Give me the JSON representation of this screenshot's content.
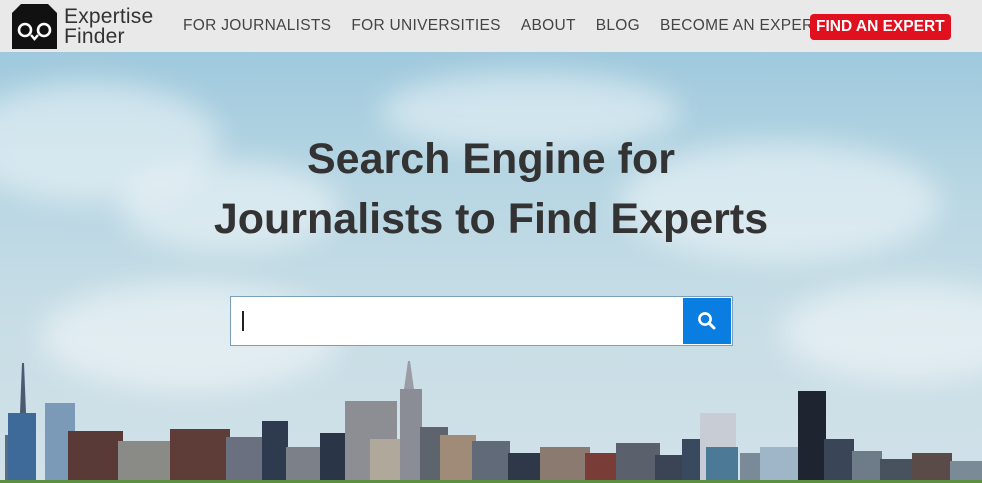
{
  "brand": {
    "line1": "Expertise",
    "line2": "Finder",
    "icon": "owl-logo-icon"
  },
  "nav": {
    "items": [
      {
        "label": "FOR JOURNALISTS"
      },
      {
        "label": "FOR UNIVERSITIES"
      },
      {
        "label": "ABOUT"
      },
      {
        "label": "BLOG"
      },
      {
        "label": "BECOME AN EXPERT"
      }
    ],
    "cta_label": "FIND AN EXPERT",
    "cta_color": "#e0101e"
  },
  "hero": {
    "headline_line1": "Search Engine for",
    "headline_line2": "Journalists to Find Experts",
    "background": "city-skyline-photo"
  },
  "search": {
    "value": "",
    "placeholder": "",
    "button_icon": "search-icon",
    "button_color": "#0a7de0"
  }
}
